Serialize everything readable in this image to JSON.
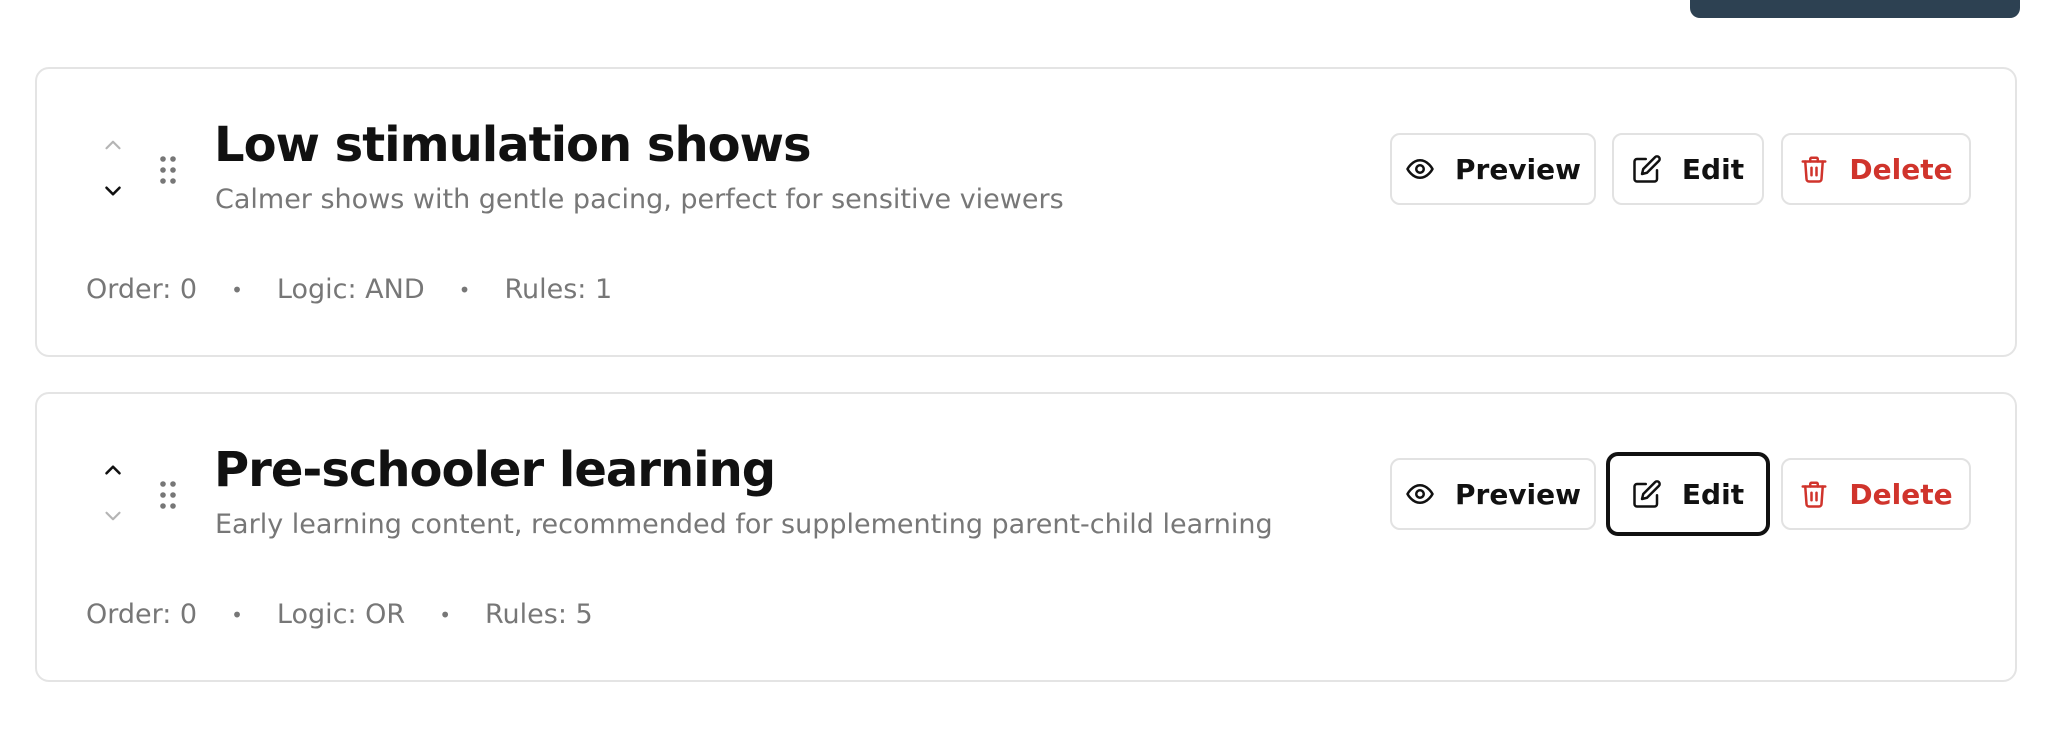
{
  "cards": [
    {
      "title": "Low stimulation shows",
      "description": "Calmer shows with gentle pacing, perfect for sensitive viewers",
      "order": "Order: 0",
      "logic": "Logic: AND",
      "rules": "Rules: 1",
      "separator": "•",
      "actions": {
        "preview": "Preview",
        "edit": "Edit",
        "delete": "Delete"
      }
    },
    {
      "title": "Pre-schooler learning",
      "description": "Early learning content, recommended for supplementing parent-child learning",
      "order": "Order: 0",
      "logic": "Logic: OR",
      "rules": "Rules: 5",
      "separator": "•",
      "actions": {
        "preview": "Preview",
        "edit": "Edit",
        "delete": "Delete"
      }
    }
  ],
  "icons": {
    "move_up": "chevron-up-icon",
    "move_down": "chevron-down-icon",
    "drag": "grip-vertical-icon",
    "preview": "eye-icon",
    "edit": "edit-icon",
    "delete": "trash-icon"
  },
  "colors": {
    "danger": "#d0342c",
    "muted_text": "#777777",
    "card_border": "#e4e4e4",
    "primary_dark": "#2d4152",
    "focus_ring": "#111111"
  }
}
